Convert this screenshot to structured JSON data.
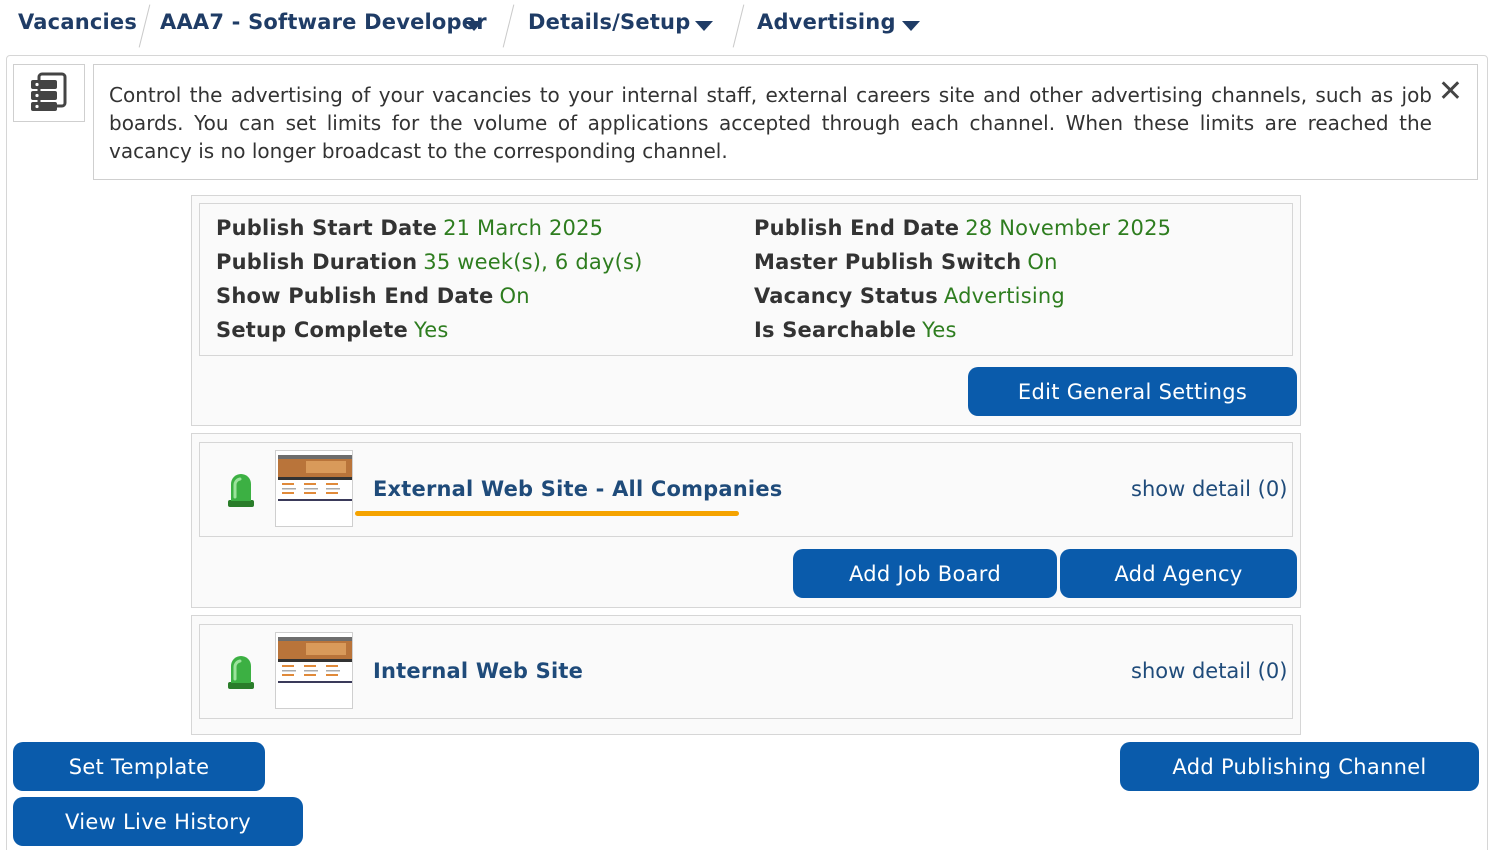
{
  "breadcrumb": {
    "items": [
      "Vacancies",
      "AAA7 - Software Developer",
      "Details/Setup",
      "Advertising"
    ]
  },
  "info": {
    "text": "Control the advertising of your vacancies to your internal staff, external careers site and other advertising channels, such as job boards. You can set limits for the volume of applications accepted through each channel. When these limits are reached the vacancy is no longer broadcast to the corresponding channel.",
    "icon": "server-stack-icon",
    "close_icon": "close-icon"
  },
  "settings": {
    "publish_start_label": "Publish Start Date",
    "publish_start_value": "21 March 2025",
    "publish_end_label": "Publish End Date",
    "publish_end_value": "28 November 2025",
    "duration_label": "Publish Duration",
    "duration_value": "35 week(s), 6 day(s)",
    "master_switch_label": "Master Publish Switch",
    "master_switch_value": "On",
    "show_end_label": "Show Publish End Date",
    "show_end_value": "On",
    "status_label": "Vacancy Status",
    "status_value": "Advertising",
    "setup_label": "Setup Complete",
    "setup_value": "Yes",
    "searchable_label": "Is Searchable",
    "searchable_value": "Yes",
    "edit_button": "Edit General Settings"
  },
  "channels": [
    {
      "name": "External Web Site - All Companies",
      "detail": "show detail (0)",
      "status_color": "#3cb043",
      "buttons": [
        "Add Job Board",
        "Add Agency"
      ]
    },
    {
      "name": "Internal Web Site",
      "detail": "show detail (0)",
      "status_color": "#3cb043"
    }
  ],
  "footer": {
    "set_template": "Set Template",
    "view_history": "View Live History",
    "add_channel": "Add Publishing Channel"
  },
  "colors": {
    "primary": "#0a5bab",
    "value_green": "#2e7d1f",
    "link_blue": "#1f4b7a",
    "highlight": "#f5a300"
  }
}
